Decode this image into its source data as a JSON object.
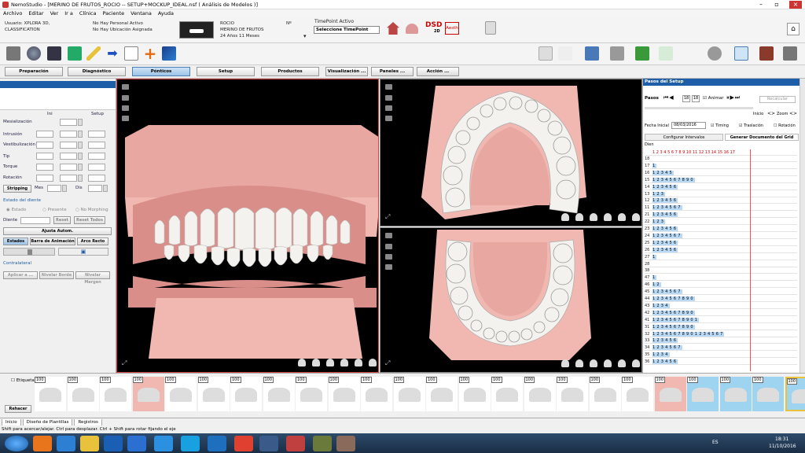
{
  "window": {
    "title": "NemoStudio - [MERINO DE FRUTOS_ROCIO -- SETUP+MOCKUP_IDEAL.nsf ( Análisis de Modelos )]"
  },
  "menu": [
    "Archivo",
    "Editar",
    "Ver",
    "Ir a",
    "Clínica",
    "Paciente",
    "Ventana",
    "Ayuda"
  ],
  "info": {
    "user": "Usuario: XPLORA 3D,",
    "user2": "CLASSIFICATION",
    "personal": "No Hay Personal Activo",
    "location": "No Hay Ubicación Asignada",
    "patient_first": "ROCIO",
    "patient_last": "MERINO DE FRUTOS",
    "age": "24 Años 11 Meses",
    "n_label": "Nº",
    "timepoint_label": "TimePoint Activo",
    "timepoint_value": "Seleccione TimePoint",
    "dsd": "DSD",
    "dsd_sub": "2D",
    "aesth": "Aesth"
  },
  "modes": [
    "Preparación",
    "Diagnóstico",
    "Pónticos",
    "Setup",
    "Productos",
    "Visualización ...",
    "Paneles ...",
    "Acción ..."
  ],
  "left": {
    "col_ini": "Ini",
    "col_setup": "Setup",
    "rows": [
      "Mesialización",
      "Intrusión",
      "Vestibulización",
      "Tip",
      "Torque",
      "Rotación"
    ],
    "stripping": "Stripping",
    "mes": "Mes",
    "dis": "Dis",
    "estado_title": "Estado del diente",
    "estado_opts": [
      "Estado",
      "Presente",
      "No Morphing"
    ],
    "diente": "Diente",
    "reset": "Reset",
    "reset_todos": "Reset Todos",
    "ajuste": "Ajusta Autom.",
    "tabs": [
      "Estados",
      "Barra de Animación",
      "Arco Recto"
    ],
    "contralateral": "Contralateral",
    "bottom_btns": [
      "Aplicar a ...",
      "Nivelar Borde",
      "Nivelar Margen"
    ]
  },
  "right": {
    "title": "Pasos del Setup",
    "pasos": "Pasos",
    "step1": "18",
    "step2": "18",
    "animar": "Animar",
    "recalcular": "Recalcular",
    "inicio": "Inicio",
    "zoom": "Zoom",
    "fecha_label": "Fecha Inicial",
    "fecha": "08/03/2016",
    "timing": "Timing",
    "traslacion": "Traslación",
    "rotacion": "Rotación",
    "tab1": "Configurar Intervalos",
    "tab2": "Generar Documento del Grid",
    "col": "Dien",
    "rows": [
      [
        "18",
        ""
      ],
      [
        "17",
        "1"
      ],
      [
        "16",
        "12345"
      ],
      [
        "15",
        "1234567890"
      ],
      [
        "14",
        "123456"
      ],
      [
        "13",
        "123"
      ],
      [
        "12",
        "123456"
      ],
      [
        "11",
        "1234567"
      ],
      [
        "21",
        "123456"
      ],
      [
        "22",
        "123"
      ],
      [
        "23",
        "123456"
      ],
      [
        "24",
        "1234567"
      ],
      [
        "25",
        "123456"
      ],
      [
        "26",
        "123456"
      ],
      [
        "27",
        "1"
      ],
      [
        "28",
        ""
      ],
      [
        "38",
        ""
      ],
      [
        "47",
        "1"
      ],
      [
        "46",
        "12"
      ],
      [
        "45",
        "1234567"
      ],
      [
        "44",
        "1234567890"
      ],
      [
        "43",
        "1234"
      ],
      [
        "42",
        "1234567890"
      ],
      [
        "41",
        "12345678901"
      ],
      [
        "31",
        "1234567890"
      ],
      [
        "32",
        "12345678901234567"
      ],
      [
        "33",
        "123456"
      ],
      [
        "34",
        "1234567"
      ],
      [
        "35",
        "1234"
      ],
      [
        "36",
        "123456"
      ]
    ],
    "header_row": "1 2 3 4 5 6 7 8 9 10 11 12 13 14 15 16 17"
  },
  "bottom": {
    "etiqueta": "Etiqueta",
    "rehacer": "Rehacer",
    "pct": "100",
    "thumb_count": 24
  },
  "tabs": [
    "Inicio",
    "Diseño de Plantillas",
    "Registros"
  ],
  "status": "Shift para acercar/alejar. Ctrl para desplazar. Ctrl + Shift para rotar fijando el eje",
  "tray": {
    "lang": "ES",
    "time": "18:31",
    "date": "11/10/2016"
  },
  "colors": {
    "accent": "#1e5ea8",
    "gum": "#e9a7a2",
    "tooth": "#f4f2ee"
  }
}
